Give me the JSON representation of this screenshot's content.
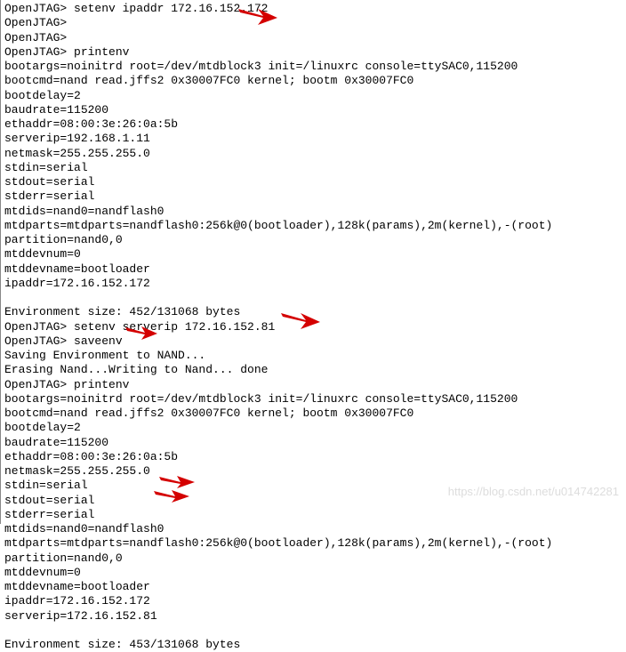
{
  "prompt": "OpenJTAG> ",
  "cmds": {
    "setenv_ipaddr": "setenv ipaddr 172.16.152.172",
    "printenv1": "printenv",
    "setenv_serverip": "setenv serverip 172.16.152.81",
    "saveenv": "saveenv",
    "printenv2": "printenv"
  },
  "env1": {
    "bootargs": "bootargs=noinitrd root=/dev/mtdblock3 init=/linuxrc console=ttySAC0,115200",
    "bootcmd": "bootcmd=nand read.jffs2 0x30007FC0 kernel; bootm 0x30007FC0",
    "bootdelay": "bootdelay=2",
    "baudrate": "baudrate=115200",
    "ethaddr": "ethaddr=08:00:3e:26:0a:5b",
    "serverip": "serverip=192.168.1.11",
    "netmask": "netmask=255.255.255.0",
    "stdin": "stdin=serial",
    "stdout": "stdout=serial",
    "stderr": "stderr=serial",
    "mtdids": "mtdids=nand0=nandflash0",
    "mtdparts": "mtdparts=mtdparts=nandflash0:256k@0(bootloader),128k(params),2m(kernel),-(root)",
    "partition": "partition=nand0,0",
    "mtddevnum": "mtddevnum=0",
    "mtddevname": "mtddevname=bootloader",
    "ipaddr": "ipaddr=172.16.152.172",
    "size": "Environment size: 452/131068 bytes"
  },
  "save_msg1": "Saving Environment to NAND...",
  "save_msg2": "Erasing Nand...Writing to Nand... done",
  "env2": {
    "bootargs": "bootargs=noinitrd root=/dev/mtdblock3 init=/linuxrc console=ttySAC0,115200",
    "bootcmd": "bootcmd=nand read.jffs2 0x30007FC0 kernel; bootm 0x30007FC0",
    "bootdelay": "bootdelay=2",
    "baudrate": "baudrate=115200",
    "ethaddr": "ethaddr=08:00:3e:26:0a:5b",
    "netmask": "netmask=255.255.255.0",
    "stdin": "stdin=serial",
    "stdout": "stdout=serial",
    "stderr": "stderr=serial",
    "mtdids": "mtdids=nand0=nandflash0",
    "mtdparts": "mtdparts=mtdparts=nandflash0:256k@0(bootloader),128k(params),2m(kernel),-(root)",
    "partition": "partition=nand0,0",
    "mtddevnum": "mtddevnum=0",
    "mtddevname": "mtddevname=bootloader",
    "ipaddr": "ipaddr=172.16.152.172",
    "serverip": "serverip=172.16.152.81",
    "size": "Environment size: 453/131068 bytes"
  },
  "watermark": "https://blog.csdn.net/u014742281"
}
